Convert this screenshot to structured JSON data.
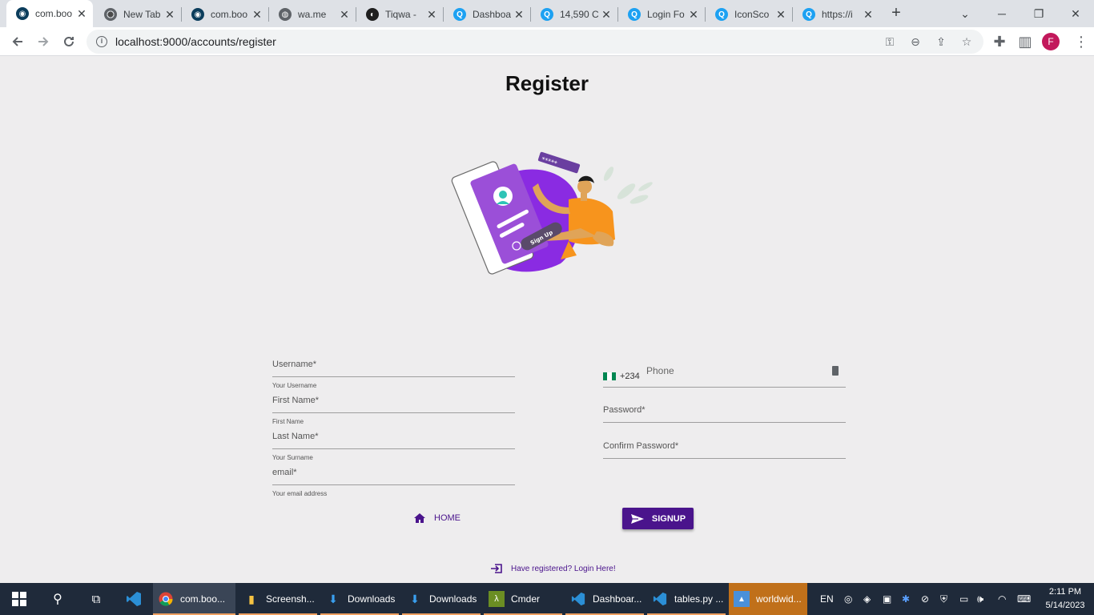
{
  "browser": {
    "tabs": [
      {
        "title": "com.boo",
        "active": true,
        "icon": "site-icon"
      },
      {
        "title": "New Tab",
        "active": false,
        "icon": "chrome-icon"
      },
      {
        "title": "com.boo",
        "active": false,
        "icon": "site-icon"
      },
      {
        "title": "wa.me",
        "active": false,
        "icon": "globe-icon"
      },
      {
        "title": "Tiqwa - ",
        "active": false,
        "icon": "tiqwa-icon"
      },
      {
        "title": "Dashboa",
        "active": false,
        "icon": "q-icon"
      },
      {
        "title": "14,590 C",
        "active": false,
        "icon": "q-icon"
      },
      {
        "title": "Login Fo",
        "active": false,
        "icon": "q-icon"
      },
      {
        "title": "IconSco",
        "active": false,
        "icon": "q-icon"
      },
      {
        "title": "https://i",
        "active": false,
        "icon": "q-icon"
      }
    ],
    "new_tab_label": "+",
    "url": "localhost:9000/accounts/register",
    "profile_initial": "F"
  },
  "page": {
    "title": "Register",
    "illustration": {
      "sign_up_text": "Sign Up",
      "password_stars": "*****"
    },
    "left_fields": [
      {
        "label": "Username*",
        "help": "Your Username"
      },
      {
        "label": "First Name*",
        "help": "First Name"
      },
      {
        "label": "Last Name*",
        "help": "Your Surname"
      },
      {
        "label": "email*",
        "help": "Your email address"
      }
    ],
    "phone": {
      "dial_code": "+234",
      "placeholder": "Phone"
    },
    "right_fields": [
      {
        "label": "Password*"
      },
      {
        "label": "Confirm Password*"
      }
    ],
    "home_label": "HOME",
    "signup_label": "SIGNUP",
    "login_link": "Have registered? Login Here!"
  },
  "taskbar": {
    "apps": [
      {
        "label": "com.boo...",
        "icon": "chrome-icon",
        "active": true
      },
      {
        "label": "Screensh...",
        "icon": "folder-icon"
      },
      {
        "label": "Downloads",
        "icon": "download-icon"
      },
      {
        "label": "Downloads",
        "icon": "download-icon"
      },
      {
        "label": "Cmder",
        "icon": "cmder-icon"
      },
      {
        "label": "Dashboar...",
        "icon": "vscode-icon"
      },
      {
        "label": "tables.py ...",
        "icon": "vscode-icon"
      },
      {
        "label": "worldwid...",
        "icon": "photos-icon"
      }
    ],
    "language": "EN",
    "time": "2:11 PM",
    "date": "5/14/2023"
  },
  "colors": {
    "accent": "#4a148c",
    "page_bg": "#eeedee",
    "illustration_purple": "#8a2be2",
    "illustration_orange": "#f7941d"
  }
}
